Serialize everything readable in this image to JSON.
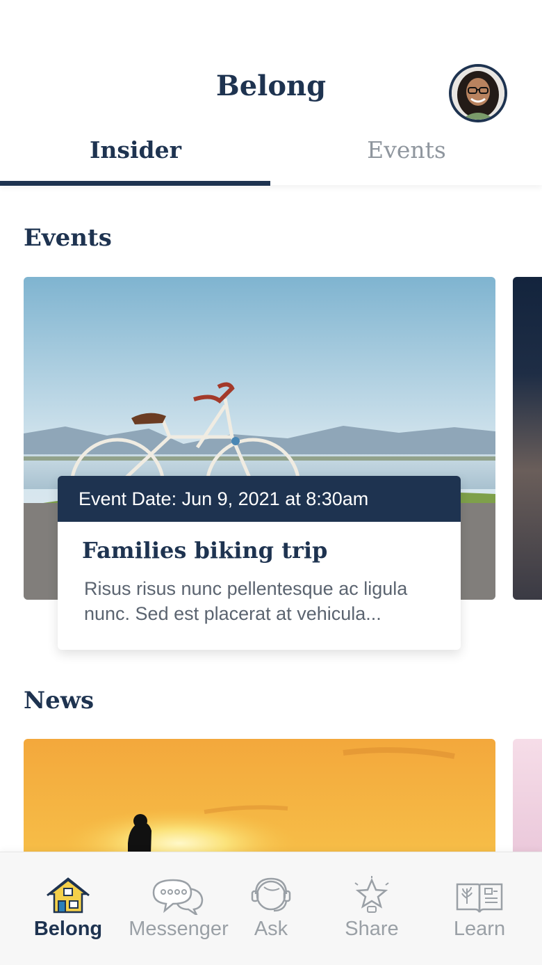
{
  "header": {
    "title": "Belong",
    "avatar_alt": "profile-avatar"
  },
  "tabs": [
    {
      "label": "Insider",
      "active": true
    },
    {
      "label": "Events",
      "active": false
    }
  ],
  "sections": {
    "events_title": "Events",
    "news_title": "News"
  },
  "event_card": {
    "date_label": "Event Date: Jun 9, 2021 at 8:30am",
    "title": "Families biking trip",
    "description": "Risus risus nunc pellentesque ac ligula nunc. Sed est placerat at vehicula..."
  },
  "bottom_nav": [
    {
      "label": "Belong",
      "icon": "home-icon",
      "active": true
    },
    {
      "label": "Messenger",
      "icon": "chat-bubbles-icon",
      "active": false
    },
    {
      "label": "Ask",
      "icon": "headset-icon",
      "active": false
    },
    {
      "label": "Share",
      "icon": "star-lightbulb-icon",
      "active": false
    },
    {
      "label": "Learn",
      "icon": "book-icon",
      "active": false
    }
  ],
  "colors": {
    "primary": "#1e3350",
    "inactive": "#8f969e"
  }
}
